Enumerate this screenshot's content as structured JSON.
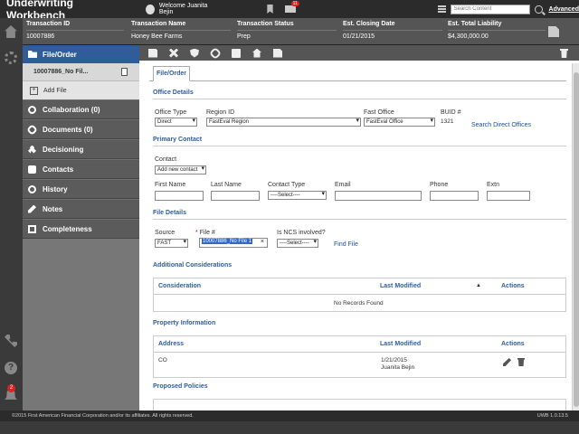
{
  "app": {
    "title": "Underwriting Workbench",
    "welcome": "Welcome Juanita Bejin",
    "mail_count": "11",
    "search_placeholder": "Search Content",
    "advanced": "Advanced"
  },
  "transaction": {
    "columns": [
      {
        "label": "Transaction ID",
        "value": "10007886"
      },
      {
        "label": "Transaction Name",
        "value": "Honey Bee Farms"
      },
      {
        "label": "Transaction Status",
        "value": "Prep"
      },
      {
        "label": "Est. Closing Date",
        "value": "01/21/2015"
      },
      {
        "label": "Est. Total Liability",
        "value": "$4,300,000.00"
      }
    ]
  },
  "nav": {
    "active": "File/Order",
    "sub_file": "10007886_No Fil...",
    "add_file": "Add File",
    "items": [
      "Collaboration (0)",
      "Documents (0)",
      "Decisioning",
      "Contacts",
      "History",
      "Notes",
      "Completeness"
    ]
  },
  "rail": {
    "notification_count": "2"
  },
  "main": {
    "tab": "File/Order",
    "office": {
      "section": "Office Details",
      "office_type_label": "Office Type",
      "office_type_value": "Direct",
      "region_label": "Region ID",
      "region_value": "FastEval Region",
      "fast_office_label": "Fast Office",
      "fast_office_value": "FastEval Office",
      "buid_label": "BUID #",
      "buid_value": "1321",
      "search_link": "Search Direct Offices"
    },
    "contact": {
      "section": "Primary Contact",
      "contact_label": "Contact",
      "contact_value": "Add new contact",
      "first_name": "First Name",
      "last_name": "Last Name",
      "contact_type": "Contact Type",
      "contact_type_value": "----Select----",
      "email": "Email",
      "phone": "Phone",
      "extn": "Extn"
    },
    "file": {
      "section": "File Details",
      "source_label": "Source",
      "source_value": "FAST",
      "file_label": "File #",
      "file_value": "10007886_No File 1",
      "ncs_label": "Is NCS involved?",
      "ncs_value": "----Select----",
      "find_file": "Find File"
    },
    "additional": {
      "section": "Additional Considerations",
      "headers": [
        "Consideration",
        "Last Modified",
        "Actions"
      ],
      "empty": "No Records Found"
    },
    "property": {
      "section": "Property Information",
      "headers": [
        "Address",
        "Last Modified",
        "Actions"
      ],
      "row": {
        "address": "CO",
        "date": "1/21/2015",
        "user": "Juanita Bejin"
      }
    },
    "policies": {
      "section": "Proposed Policies"
    }
  },
  "footer": {
    "copyright": "©2015 First American Financial Corporation and/or its affiliates. All rights reserved.",
    "version": "UWB 1.0.13.5"
  }
}
